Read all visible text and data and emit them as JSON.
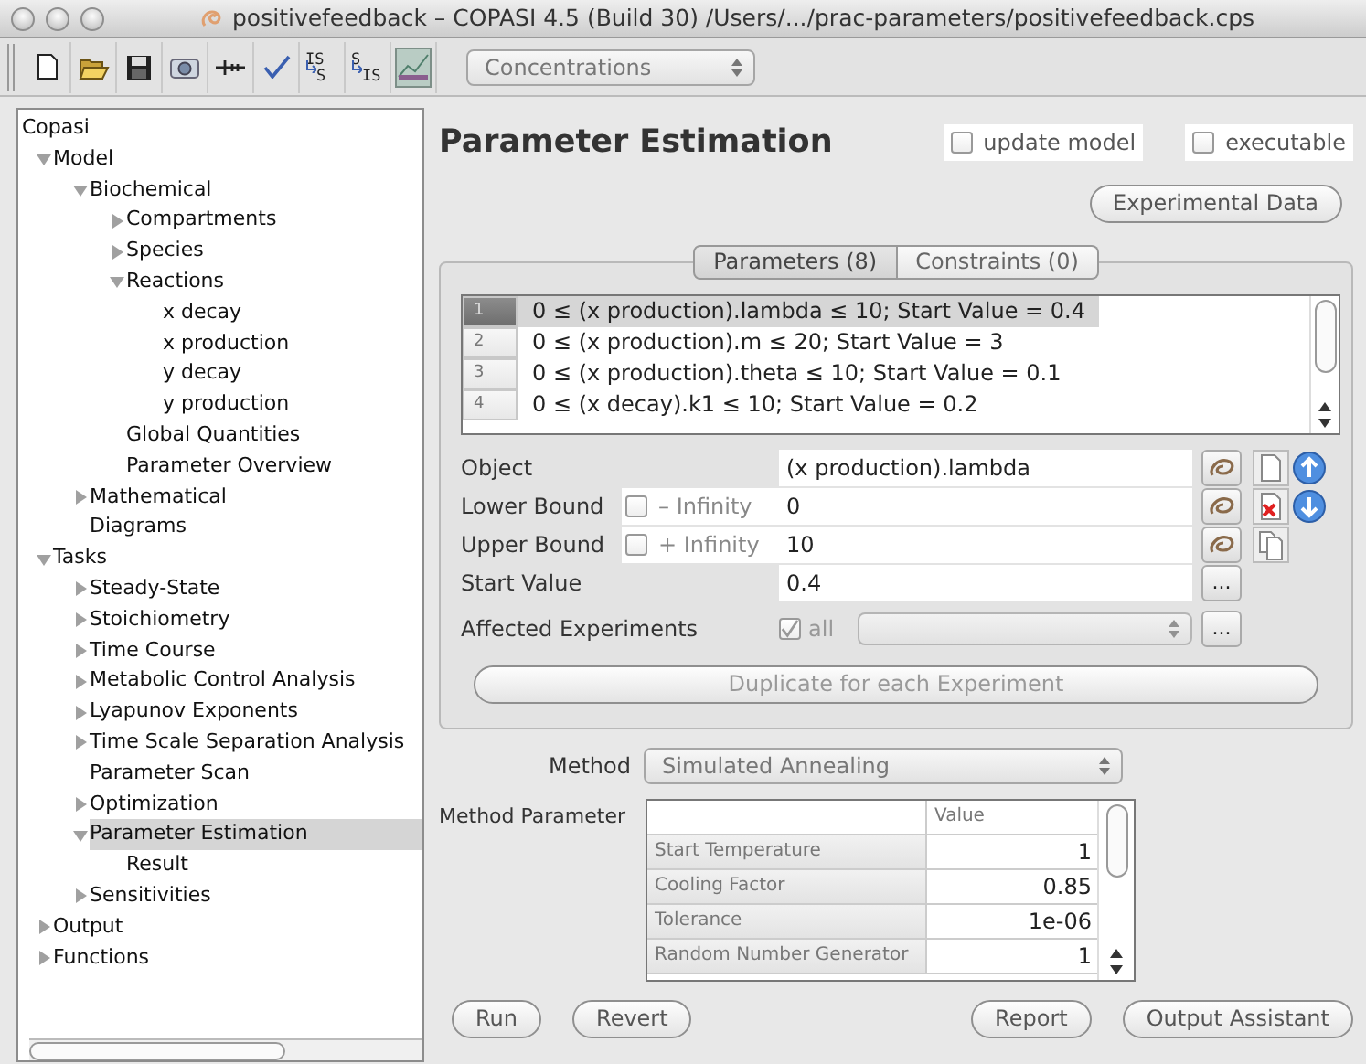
{
  "window": {
    "title": "positivefeedback – COPASI 4.5 (Build 30) /Users/.../prac-parameters/positivefeedback.cps"
  },
  "toolbar": {
    "conversion_buttons": [
      {
        "top": "IS",
        "bottom": "S"
      },
      {
        "top": "S",
        "bottom": "IS"
      }
    ],
    "unit_select": {
      "value": "Concentrations"
    }
  },
  "tree": {
    "items": [
      {
        "label": "Copasi",
        "selected": false,
        "children": [
          {
            "label": "Model",
            "expanded": true,
            "selected": false,
            "children": [
              {
                "label": "Biochemical",
                "expanded": true,
                "selected": false,
                "children": [
                  {
                    "label": "Compartments",
                    "expanded": false,
                    "selected": false
                  },
                  {
                    "label": "Species",
                    "expanded": false,
                    "selected": false
                  },
                  {
                    "label": "Reactions",
                    "expanded": true,
                    "selected": false,
                    "children": [
                      {
                        "label": "x decay",
                        "selected": false
                      },
                      {
                        "label": "x production",
                        "selected": false
                      },
                      {
                        "label": "y decay",
                        "selected": false
                      },
                      {
                        "label": "y production",
                        "selected": false
                      }
                    ]
                  },
                  {
                    "label": "Global Quantities",
                    "selected": false
                  },
                  {
                    "label": "Parameter Overview",
                    "selected": false
                  }
                ]
              },
              {
                "label": "Mathematical",
                "expanded": false,
                "selected": false
              },
              {
                "label": "Diagrams",
                "selected": false
              }
            ]
          },
          {
            "label": "Tasks",
            "expanded": true,
            "selected": false,
            "children": [
              {
                "label": "Steady-State",
                "expanded": false,
                "selected": false
              },
              {
                "label": "Stoichiometry",
                "expanded": false,
                "selected": false
              },
              {
                "label": "Time Course",
                "expanded": false,
                "selected": false
              },
              {
                "label": "Metabolic Control Analysis",
                "expanded": false,
                "selected": false
              },
              {
                "label": "Lyapunov Exponents",
                "expanded": false,
                "selected": false
              },
              {
                "label": "Time Scale Separation Analysis",
                "expanded": false,
                "selected": false
              },
              {
                "label": "Parameter Scan",
                "selected": false
              },
              {
                "label": "Optimization",
                "expanded": false,
                "selected": false
              },
              {
                "label": "Parameter Estimation",
                "expanded": true,
                "selected": true,
                "children": [
                  {
                    "label": "Result",
                    "selected": false
                  }
                ]
              },
              {
                "label": "Sensitivities",
                "expanded": false,
                "selected": false
              }
            ]
          },
          {
            "label": "Output",
            "expanded": false,
            "selected": false
          },
          {
            "label": "Functions",
            "expanded": false,
            "selected": false
          }
        ]
      }
    ]
  },
  "panel": {
    "title": "Parameter Estimation",
    "options": [
      {
        "label": "update model",
        "checked": false
      },
      {
        "label": "executable",
        "checked": false
      }
    ],
    "experimental_data_button": "Experimental Data",
    "tabs": [
      {
        "label": "Parameters (8)",
        "selected": true
      },
      {
        "label": "Constraints (0)",
        "selected": false
      }
    ],
    "parameters": [
      {
        "number": "1",
        "text": "0 ≤ (x production).lambda ≤ 10; Start Value = 0.4",
        "selected": true
      },
      {
        "number": "2",
        "text": "0 ≤ (x production).m ≤ 20; Start Value = 3",
        "selected": false
      },
      {
        "number": "3",
        "text": "0 ≤ (x production).theta ≤ 10; Start Value = 0.1",
        "selected": false
      },
      {
        "number": "4",
        "text": "0 ≤ (x decay).k1 ≤ 10; Start Value = 0.2",
        "selected": false
      }
    ],
    "object": {
      "label": "Object",
      "value": "(x production).lambda"
    },
    "lower_bound": {
      "label": "Lower Bound",
      "infinity_label": "– Infinity",
      "infinity_checked": false,
      "value": "0"
    },
    "upper_bound": {
      "label": "Upper Bound",
      "infinity_label": "+ Infinity",
      "infinity_checked": false,
      "value": "10"
    },
    "start_value": {
      "label": "Start Value",
      "value": "0.4",
      "more_button": "..."
    },
    "affected_experiments": {
      "label": "Affected Experiments",
      "all_label": "all",
      "all_checked": true,
      "disabled": true,
      "more_button": "..."
    },
    "duplicate_button": {
      "label": "Duplicate for each Experiment",
      "disabled": true
    },
    "method": {
      "label": "Method",
      "value": "Simulated Annealing"
    },
    "method_parameters": {
      "label": "Method Parameter",
      "value_column": "Value",
      "rows": [
        {
          "name": "Start Temperature",
          "value": "1"
        },
        {
          "name": "Cooling Factor",
          "value": "0.85"
        },
        {
          "name": "Tolerance",
          "value": "1e-06"
        },
        {
          "name": "Random Number Generator",
          "value": "1"
        }
      ]
    },
    "left_buttons": [
      "Run",
      "Revert"
    ],
    "right_buttons": [
      "Report",
      "Output Assistant"
    ]
  }
}
